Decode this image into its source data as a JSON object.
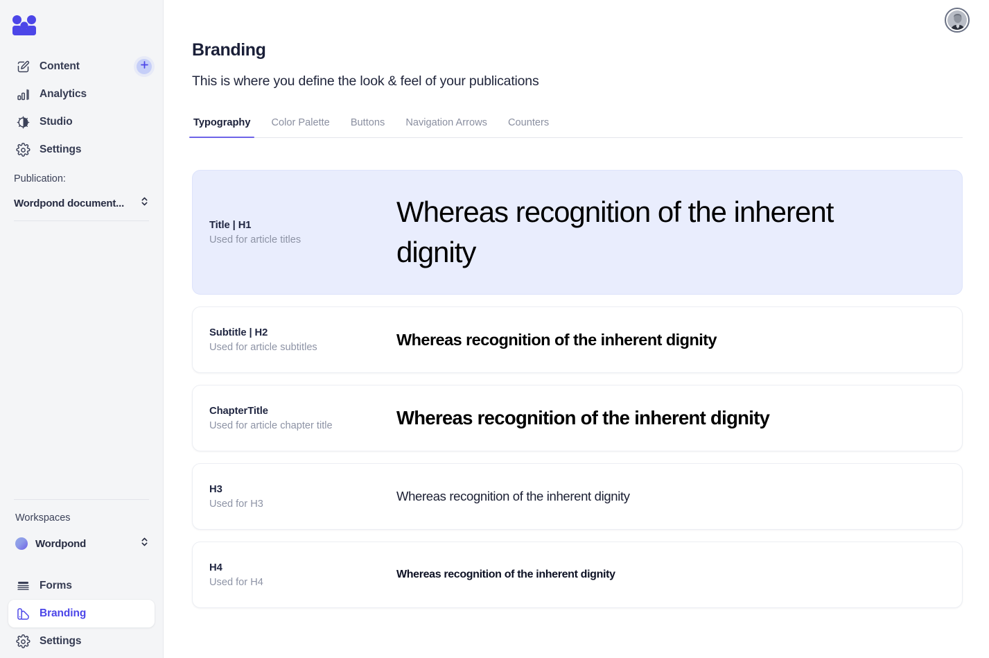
{
  "brand": {
    "logo_icon": "three-people-logo",
    "accent_color": "#4c46e8",
    "highlight_bg": "#e9edfd",
    "sidebar_bg": "#f4f5f7"
  },
  "sidebar": {
    "primary_items": [
      {
        "label": "Content",
        "icon": "pencil-square-icon",
        "has_add_button": true
      },
      {
        "label": "Analytics",
        "icon": "bar-chart-icon",
        "has_add_button": false
      },
      {
        "label": "Studio",
        "icon": "cog-disc-icon",
        "has_add_button": false
      },
      {
        "label": "Settings",
        "icon": "gear-icon",
        "has_add_button": false
      }
    ],
    "add_button_icon": "plus-icon",
    "publication": {
      "label": "Publication:",
      "selected": "Wordpond document...",
      "chevron_icon": "chevron-up-down-icon"
    },
    "workspaces": {
      "label": "Workspaces",
      "selected": "Wordpond",
      "chevron_icon": "chevron-up-down-icon"
    },
    "secondary_items": [
      {
        "label": "Forms",
        "icon": "lines-list-icon",
        "active": false
      },
      {
        "label": "Branding",
        "icon": "palette-icon",
        "active": true
      },
      {
        "label": "Settings",
        "icon": "gear-icon",
        "active": false
      }
    ]
  },
  "topbar": {
    "avatar_icon": "user-avatar"
  },
  "page": {
    "title": "Branding",
    "subtitle": "This is where you define the look & feel of your publications"
  },
  "tabs": [
    {
      "label": "Typography",
      "active": true
    },
    {
      "label": "Color Palette",
      "active": false
    },
    {
      "label": "Buttons",
      "active": false
    },
    {
      "label": "Navigation Arrows",
      "active": false
    },
    {
      "label": "Counters",
      "active": false
    }
  ],
  "typography_cards": [
    {
      "name": "Title | H1",
      "description": "Used for article titles",
      "sample": "Whereas recognition of the inherent dignity",
      "selected": true
    },
    {
      "name": "Subtitle | H2",
      "description": "Used for article subtitles",
      "sample": "Whereas recognition of the inherent dignity",
      "selected": false
    },
    {
      "name": "ChapterTitle",
      "description": "Used for article chapter title",
      "sample": "Whereas recognition of the inherent dignity",
      "selected": false
    },
    {
      "name": "H3",
      "description": "Used for H3",
      "sample": "Whereas recognition of the inherent dignity",
      "selected": false
    },
    {
      "name": "H4",
      "description": "Used for H4",
      "sample": "Whereas recognition of the inherent dignity",
      "selected": false
    }
  ]
}
